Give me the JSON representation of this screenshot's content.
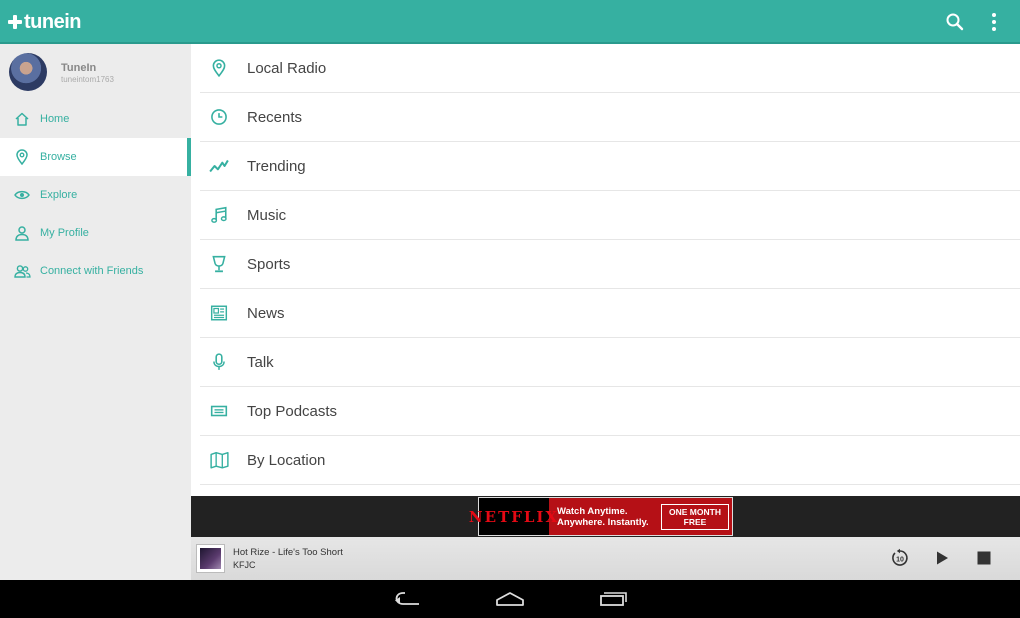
{
  "app": {
    "logo_text": "tunein"
  },
  "toolbar": {
    "search_icon": "search-icon",
    "menu_icon": "more-vert-icon"
  },
  "profile": {
    "name": "TuneIn",
    "handle": "tuneintom1763"
  },
  "sidebar": {
    "items": [
      {
        "label": "Home",
        "icon": "home-icon",
        "active": false
      },
      {
        "label": "Browse",
        "icon": "location-pin-icon",
        "active": true
      },
      {
        "label": "Explore",
        "icon": "eye-icon",
        "active": false
      },
      {
        "label": "My Profile",
        "icon": "person-icon",
        "active": false
      },
      {
        "label": "Connect with Friends",
        "icon": "friends-icon",
        "active": false
      }
    ]
  },
  "browse": {
    "items": [
      {
        "label": "Local Radio",
        "icon": "location-pin-icon"
      },
      {
        "label": "Recents",
        "icon": "clock-icon"
      },
      {
        "label": "Trending",
        "icon": "trending-icon"
      },
      {
        "label": "Music",
        "icon": "music-note-icon"
      },
      {
        "label": "Sports",
        "icon": "trophy-icon"
      },
      {
        "label": "News",
        "icon": "newspaper-icon"
      },
      {
        "label": "Talk",
        "icon": "microphone-icon"
      },
      {
        "label": "Top Podcasts",
        "icon": "podcast-icon"
      },
      {
        "label": "By Location",
        "icon": "map-icon"
      }
    ]
  },
  "ad": {
    "brand": "NETFLIX",
    "tagline_1": "Watch Anytime.",
    "tagline_2": "Anywhere. Instantly.",
    "cta_1": "ONE MONTH",
    "cta_2": "FREE"
  },
  "player": {
    "track": "Hot Rize - Life's Too Short",
    "station": "KFJC",
    "rewind_label": "10"
  },
  "colors": {
    "accent": "#36b0a1",
    "sidebar_bg": "#ececec",
    "text": "#444444"
  }
}
